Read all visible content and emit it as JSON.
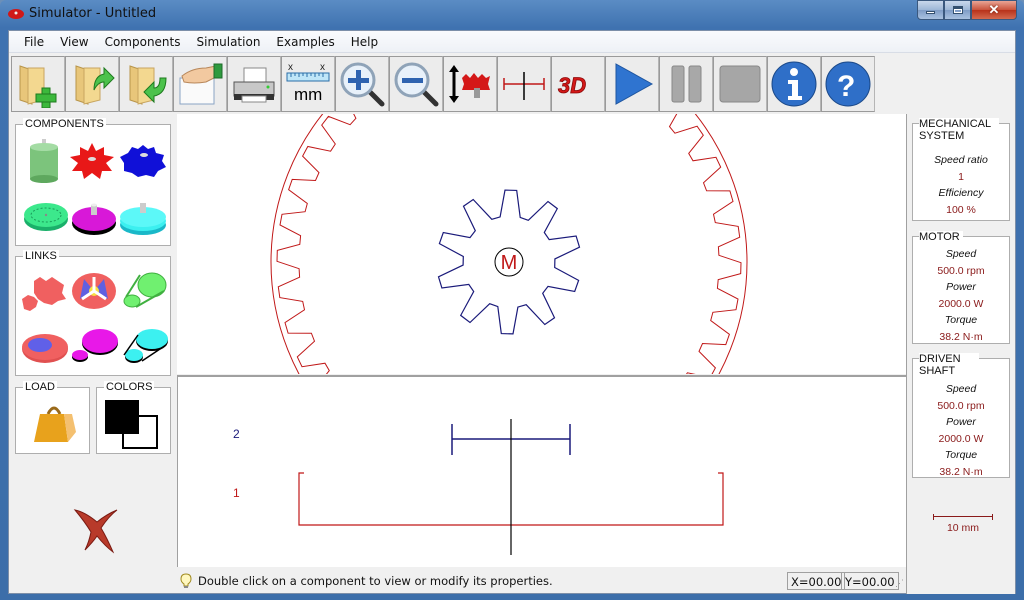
{
  "window": {
    "title": "Simulator - Untitled"
  },
  "menu": [
    "File",
    "View",
    "Components",
    "Simulation",
    "Examples",
    "Help"
  ],
  "toolbar": [
    {
      "name": "new-file-button",
      "icon": "folder-plus-icon",
      "tooltip": "New"
    },
    {
      "name": "open-file-button",
      "icon": "folder-open-icon",
      "tooltip": "Open"
    },
    {
      "name": "save-file-button",
      "icon": "folder-save-icon",
      "tooltip": "Save"
    },
    {
      "name": "select-button",
      "icon": "hand-pointer-icon",
      "tooltip": "Select"
    },
    {
      "name": "print-button",
      "icon": "printer-icon",
      "tooltip": "Print"
    },
    {
      "name": "units-button",
      "icon": "ruler-mm-icon",
      "tooltip": "Units",
      "label": "mm"
    },
    {
      "name": "zoom-in-button",
      "icon": "zoom-in-icon",
      "tooltip": "Zoom in"
    },
    {
      "name": "zoom-out-button",
      "icon": "zoom-out-icon",
      "tooltip": "Zoom out"
    },
    {
      "name": "axial-position-button",
      "icon": "gear-axial-icon",
      "tooltip": "Axial position"
    },
    {
      "name": "section-view-button",
      "icon": "section-icon",
      "tooltip": "Section"
    },
    {
      "name": "view-3d-button",
      "icon": "3d-icon",
      "tooltip": "3D",
      "label": "3D"
    },
    {
      "name": "play-button",
      "icon": "play-icon",
      "tooltip": "Start"
    },
    {
      "name": "pause-button",
      "icon": "pause-icon",
      "tooltip": "Pause"
    },
    {
      "name": "stop-button",
      "icon": "stop-icon",
      "tooltip": "Stop"
    },
    {
      "name": "info-button",
      "icon": "info-icon",
      "tooltip": "Info"
    },
    {
      "name": "help-button",
      "icon": "help-icon",
      "tooltip": "Help"
    }
  ],
  "left": {
    "components_label": "COMPONENTS",
    "components": [
      "motor-icon",
      "spur-gear-icon",
      "helical-gear-icon",
      "internal-gear-icon",
      "pulley-icon",
      "sprocket-icon"
    ],
    "links_label": "LINKS",
    "links": [
      "gear-mesh-icon",
      "planetary-icon",
      "chain-drive-icon",
      "internal-mesh-icon",
      "belt-drive-icon",
      "v-belt-drive-icon"
    ],
    "load_label": "LOAD",
    "colors_label": "COLORS"
  },
  "canvas": {
    "motor_label": "M",
    "shaft_labels": [
      "2",
      "1"
    ],
    "colors": {
      "pinion": "#1a1a7a",
      "ring": "#c01818",
      "shaft": "#000000"
    }
  },
  "right": {
    "mechanical": {
      "title": "MECHANICAL SYSTEM",
      "speed_ratio_label": "Speed ratio",
      "speed_ratio": "1",
      "efficiency_label": "Efficiency",
      "efficiency": "100 %"
    },
    "motor": {
      "title": "MOTOR",
      "speed_label": "Speed",
      "speed": "500.0 rpm",
      "power_label": "Power",
      "power": "2000.0 W",
      "torque_label": "Torque",
      "torque": "38.2 N·m"
    },
    "driven": {
      "title": "DRIVEN SHAFT",
      "speed_label": "Speed",
      "speed": "500.0 rpm",
      "power_label": "Power",
      "power": "2000.0 W",
      "torque_label": "Torque",
      "torque": "38.2 N·m"
    },
    "scale_label": "10 mm"
  },
  "status": {
    "hint": "Double click on a component to view or modify its properties.",
    "x": "X=00.00",
    "y": "Y=00.00"
  }
}
